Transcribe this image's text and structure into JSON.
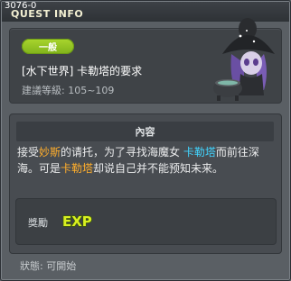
{
  "window": {
    "quest_id": "3076-0",
    "title": "QUEST INFO"
  },
  "header": {
    "category_badge": "一般",
    "quest_name": "[水下世界] 卡勒塔的要求",
    "level_label": "建議等級:",
    "level_range": "105~109"
  },
  "content": {
    "section_title": "內容",
    "description": {
      "p1": "接受",
      "n1": "妙斯",
      "p2": "的请托，为了寻找海魔女 ",
      "n2": "卡勒塔",
      "p3": "而前往深海。可是",
      "n3": "卡勒塔",
      "p4": "却说自己并不能预知未来。"
    },
    "reward_label": "獎勵",
    "reward_item": "EXP"
  },
  "footer": {
    "status_label": "狀態:",
    "status_value": "可開始"
  },
  "colors": {
    "badge_green": "#8cc322",
    "npc_orange": "#ffae2c",
    "npc_cyan": "#42d5ff",
    "exp_yellow": "#d8f020"
  },
  "icons": {
    "portrait": "sea-witch-npc-portrait",
    "reward": "exp-icon"
  }
}
